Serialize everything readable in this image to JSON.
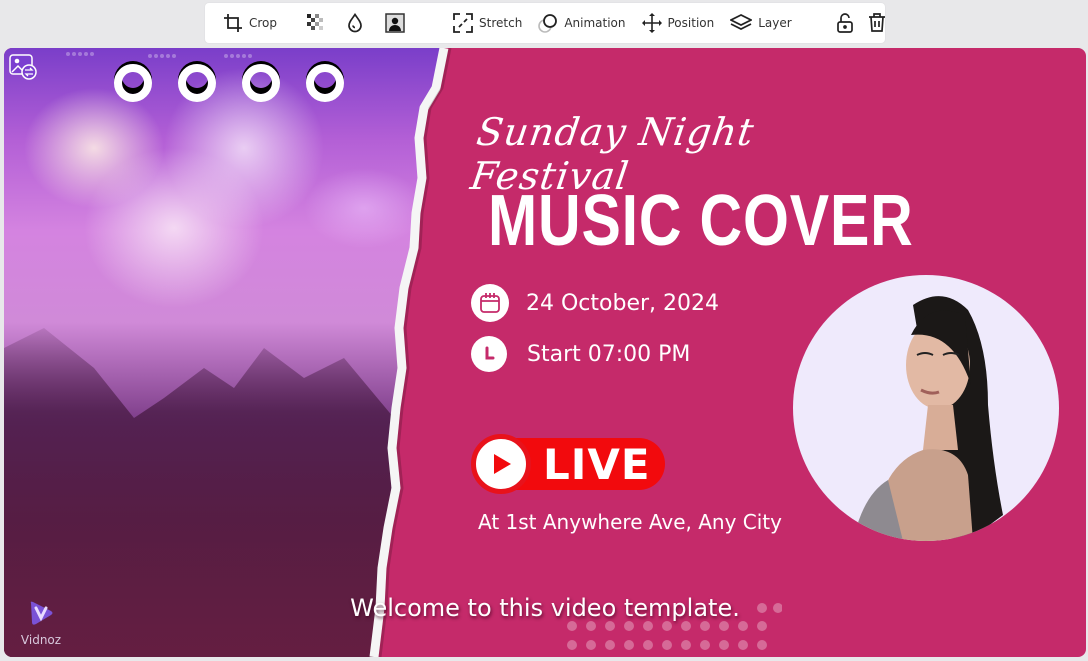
{
  "toolbar": {
    "items": [
      {
        "id": "crop",
        "label": "Crop",
        "icon": "crop-icon"
      },
      {
        "id": "transparency",
        "label": "",
        "icon": "transparency-icon"
      },
      {
        "id": "color",
        "label": "",
        "icon": "droplet-icon"
      },
      {
        "id": "remove-bg",
        "label": "",
        "icon": "portrait-frame-icon"
      },
      {
        "id": "stretch",
        "label": "Stretch",
        "icon": "expand-icon"
      },
      {
        "id": "animation",
        "label": "Animation",
        "icon": "animation-icon"
      },
      {
        "id": "position",
        "label": "Position",
        "icon": "move-arrows-icon"
      },
      {
        "id": "layer",
        "label": "Layer",
        "icon": "layers-icon"
      },
      {
        "id": "lock",
        "label": "",
        "icon": "unlock-icon"
      },
      {
        "id": "delete",
        "label": "",
        "icon": "trash-icon"
      }
    ]
  },
  "canvas": {
    "colors": {
      "background": "#c52a6a",
      "live_red": "#f20a0d",
      "portrait_bg": "#efeafc"
    },
    "script_title": "Sunday Night Festival",
    "main_title": "MUSIC COVER",
    "date": "24 October, 2024",
    "time": "Start 07:00 PM",
    "live_label": "LIVE",
    "address": "At 1st Anywhere Ave, Any City",
    "caption": "Welcome to this video template.",
    "watermark": "Vidnoz"
  }
}
